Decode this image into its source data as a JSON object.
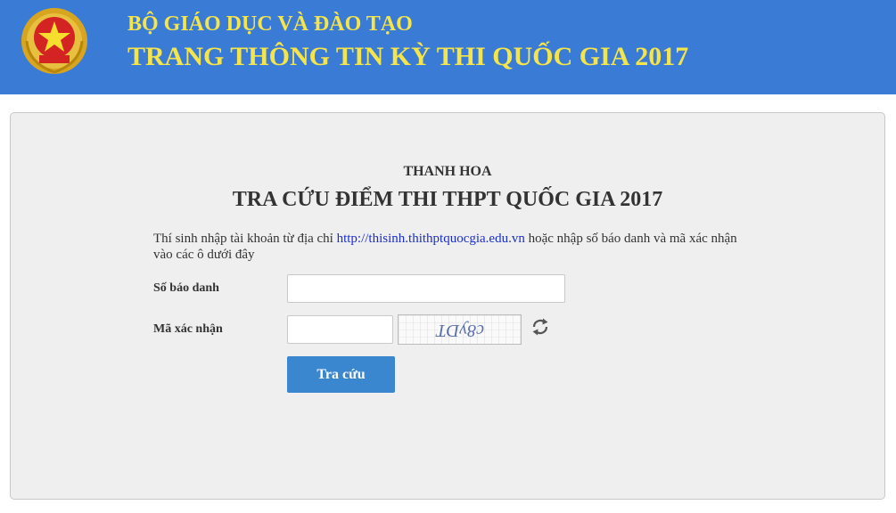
{
  "header": {
    "line1": "BỘ GIÁO DỤC VÀ ĐÀO TẠO",
    "line2": "TRANG THÔNG TIN KỲ THI QUỐC GIA 2017",
    "emblem_icon": "national-emblem-icon",
    "bg_color": "#3a7bd5",
    "text_color": "#f5e44a"
  },
  "form": {
    "province": "THANH HOA",
    "title": "TRA CỨU ĐIỂM THI THPT QUỐC GIA 2017",
    "instructions": {
      "before": "Thí sinh nhập tài khoản từ địa chỉ ",
      "link": "http://thisinh.thithptquocgia.edu.vn",
      "after": " hoặc nhập số báo danh và mã xác nhận vào các ô dưới đây"
    },
    "sbd_label": "Số báo danh",
    "sbd_value": "",
    "captcha_label": "Mã xác nhận",
    "captcha_value": "",
    "captcha_text": "c8yDT",
    "refresh_icon": "refresh-icon",
    "submit_label": "Tra cứu",
    "submit_color": "#3a86cf"
  }
}
